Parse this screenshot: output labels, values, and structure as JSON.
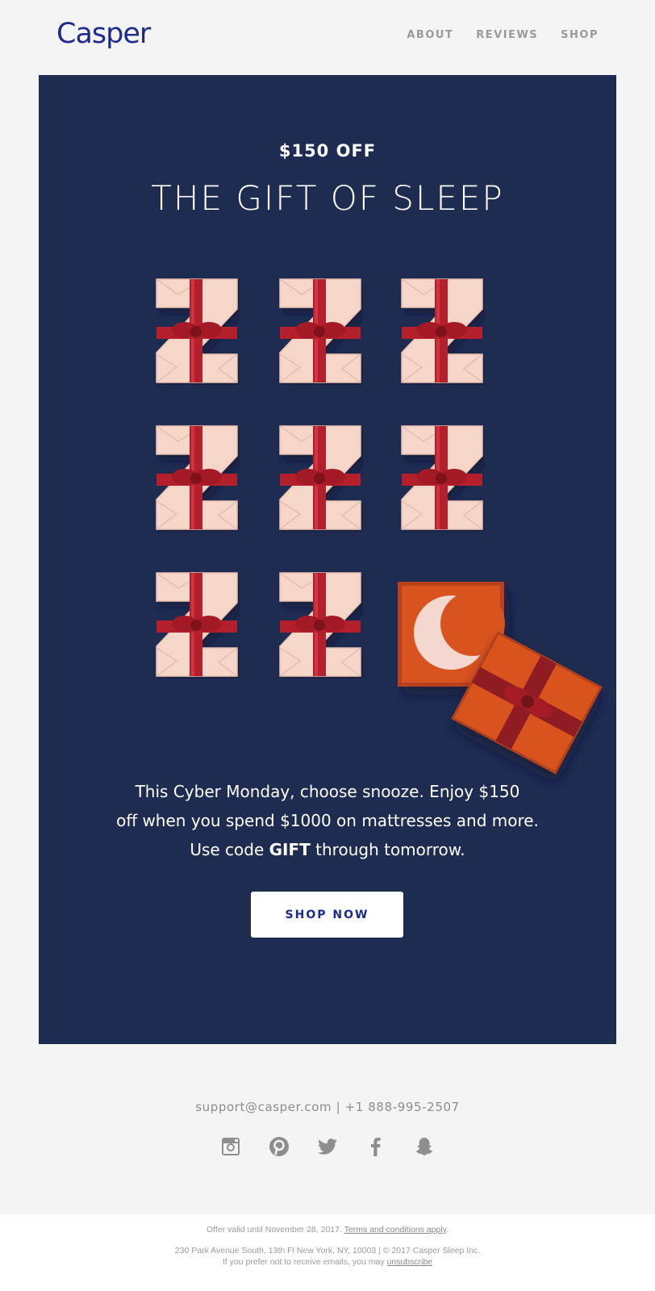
{
  "header": {
    "logo": "Casper",
    "nav": [
      "ABOUT",
      "REVIEWS",
      "SHOP"
    ]
  },
  "hero": {
    "kicker": "$150 OFF",
    "headline": "THE GIFT OF SLEEP",
    "body_line1": "This Cyber Monday, choose snooze. Enjoy $150",
    "body_line2": "off when you spend $1000 on mattresses and more.",
    "body_line3_pre": "Use code ",
    "body_line3_code": "GIFT",
    "body_line3_post": " through tomorrow.",
    "cta": "SHOP NOW",
    "colors": {
      "background": "#1e2c52",
      "gift_paper": "#f6d6c8",
      "ribbon": "#b3202c",
      "box": "#d9531e",
      "moon": "#f4d8cf"
    }
  },
  "footer": {
    "contact": "support@casper.com | +1 888-995-2507",
    "social_icons": [
      "instagram-icon",
      "pinterest-icon",
      "twitter-icon",
      "facebook-icon",
      "snapchat-icon"
    ],
    "offer_text": "Offer valid until November 28, 2017. ",
    "terms_link": "Terms and conditions apply",
    "offer_end": ".",
    "address": "230 Park Avenue South, 13th Fl New York, NY, 10003 | © 2017 Casper Sleep Inc.",
    "unsub_text": "If you prefer not to receive emails, you may ",
    "unsub_link": "unsubscribe"
  }
}
